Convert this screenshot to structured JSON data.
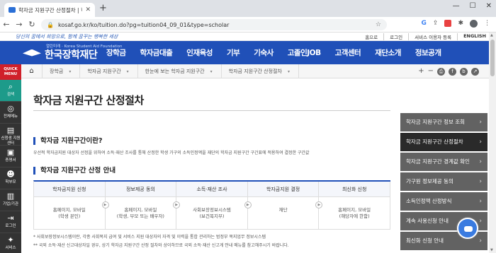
{
  "browser": {
    "tab_title": "학자금 지원구간 산정절차 | 학자",
    "url": "kosaf.go.kr/ko/tuition.do?pg=tuition04_09_01&type=scholar"
  },
  "topbar": {
    "slogan": "당신의 꿈에서 희망으로, 함께 꿈꾸는 행복한 세상",
    "links": [
      "홈으로",
      "로그인",
      "서비스 이용자 등록",
      "ENGLISH"
    ]
  },
  "header": {
    "logo_sub": "열린미래 · Korea Student Aid Foundation",
    "logo_name": "한국장학재단",
    "nav": [
      "장학금",
      "학자금대출",
      "인재육성",
      "기부",
      "기숙사",
      "고졸인JOB",
      "고객센터",
      "재단소개",
      "정보공개"
    ]
  },
  "quick": {
    "title_line1": "QUICK",
    "title_line2": "MENU",
    "items": [
      {
        "label": "검색",
        "icon": "search-icon"
      },
      {
        "label": "전체메뉴",
        "icon": "compass-icon"
      },
      {
        "label": "신청생 지원센터",
        "icon": "document-icon"
      },
      {
        "label": "증명서",
        "icon": "certificate-icon"
      },
      {
        "label": "학부모",
        "icon": "family-icon"
      },
      {
        "label": "기업/기관",
        "icon": "building-icon"
      },
      {
        "label": "로그인",
        "icon": "login-icon"
      },
      {
        "label": "서비스",
        "icon": "service-icon"
      }
    ]
  },
  "breadcrumb": [
    "장학금",
    "학자금 지원구간",
    "한눈에 보는 학자금 지원구간",
    "학자금 지원구간 산정절차"
  ],
  "tools": {
    "zoom_in": "+",
    "zoom_out": "−"
  },
  "main": {
    "page_title": "학자금 지원구간 산정절차",
    "section1_title": "학자금 지원구간이란?",
    "section1_desc": "우선적 학자금지원 대상자 선정을 위하여 소득·재산 조사를 통해 산정한 학생 가구의 소득인정액을 재단의 학자금 지원구간 구간표에 적용하여 결정한 구간값",
    "section2_title": "학자금 지원구간 산정 안내",
    "steps": [
      {
        "title": "학자금지원 신청",
        "body1": "홈페이지, 모바일",
        "body2": "(학생 본인)"
      },
      {
        "title": "정보제공 동의",
        "body1": "홈페이지, 모바일",
        "body2": "(학생, 부모 또는 배우자)"
      },
      {
        "title": "소득·재산 조사",
        "body1": "사회보장정보시스템",
        "body2": "(보건복지부)"
      },
      {
        "title": "학자금지원 결정",
        "body1": "재단",
        "body2": ""
      },
      {
        "title": "최신화 신청",
        "body1": "홈페이지, 모바일",
        "body2": "(해당자에 한함)"
      }
    ],
    "note1": "* 사회보장정보시스템이란, 각종 사회복지 급여 및 서비스 지원 대상자의 자격 및 이력을 통합 관리하는 범정부 복지업무 정보시스템",
    "note2": "** 국외 소득·재산 신고대상자일 경우, 상기 학자금 지원구간 산정 절차와 상이하므로 국외 소득·재산 신고게 안내 메뉴를 참고해주시기 바랍니다."
  },
  "side_menu": [
    "학자금 지원구간 정보 조회",
    "학자금 지원구간 산정절차",
    "학자금 지원구간 경계값 확인",
    "가구원 정보제공 동의",
    "소득인정액 산정방식",
    "계속 사용신청 안내",
    "최신화 신청 안내"
  ]
}
